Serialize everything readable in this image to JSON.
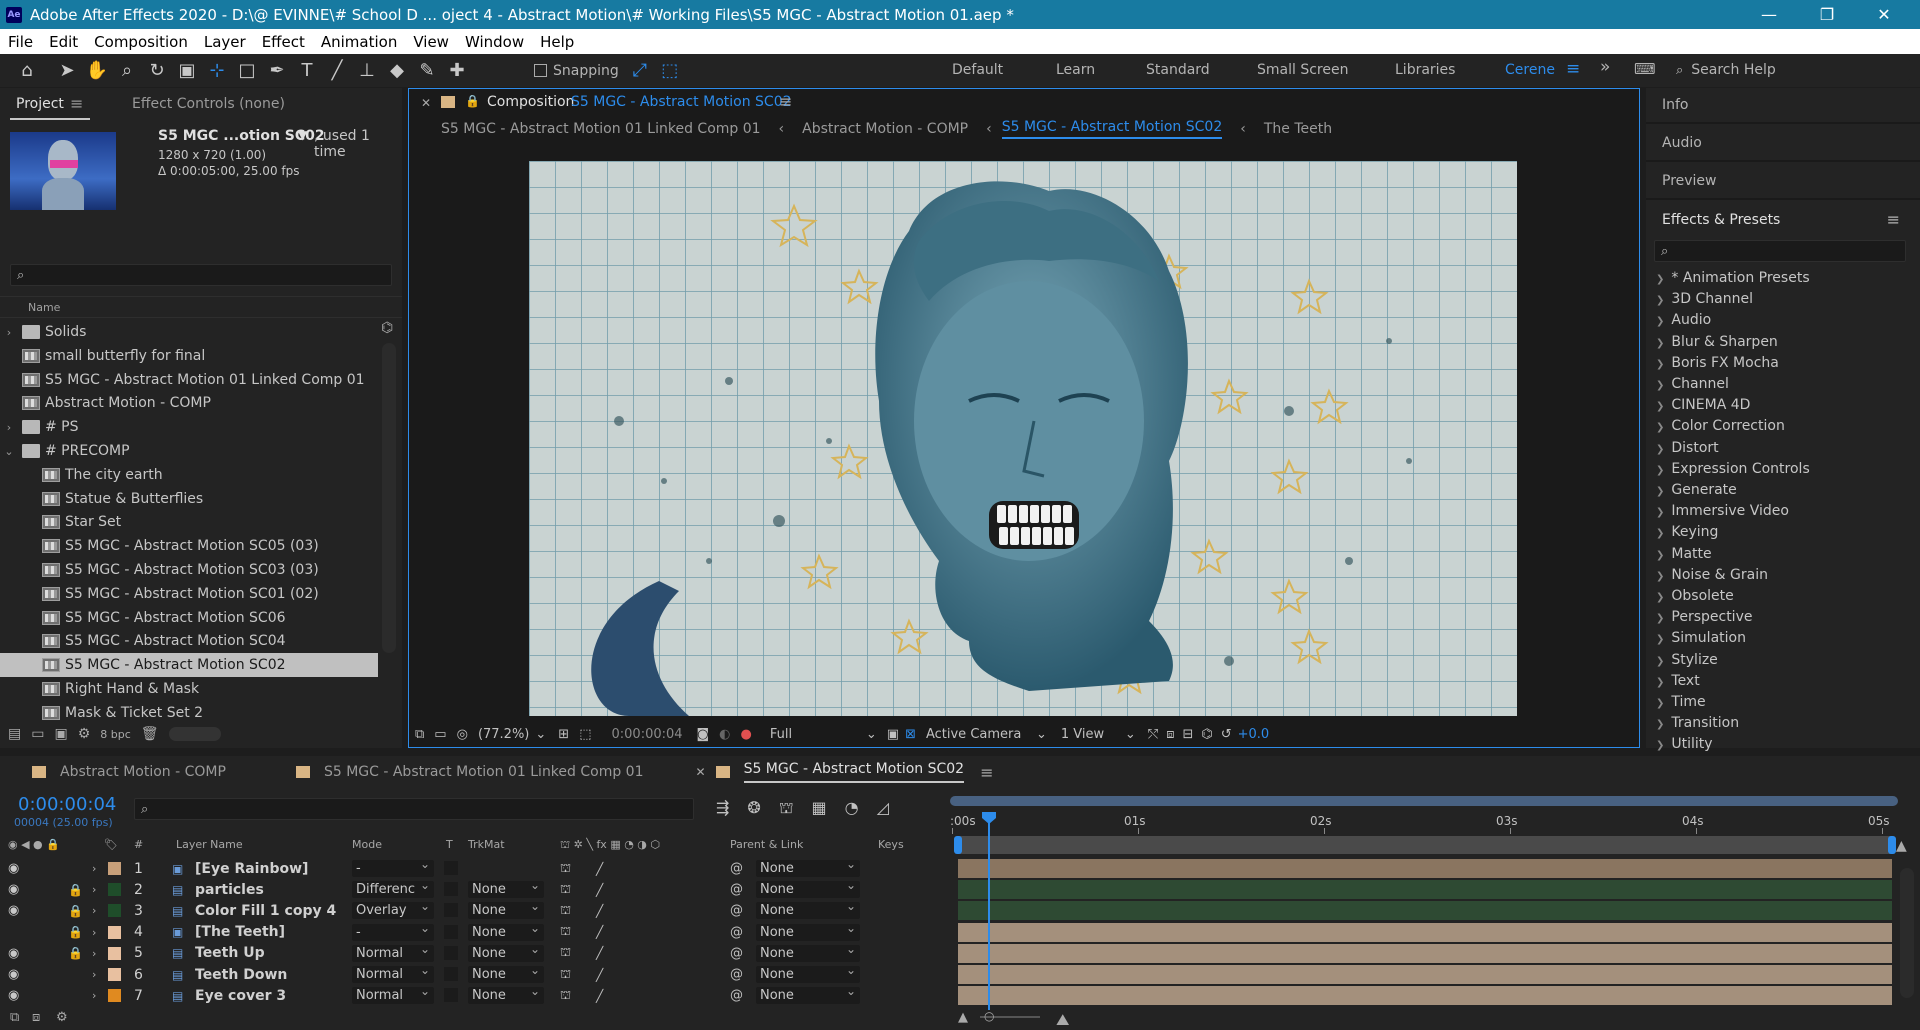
{
  "window": {
    "title": "Adobe After Effects 2020 - D:\\@ EVINNE\\# School D ... oject 4 - Abstract Motion\\# Working Files\\S5 MGC - Abstract Motion 01.aep *",
    "app_badge": "Ae",
    "controls": [
      "—",
      "❐",
      "✕"
    ]
  },
  "menu": [
    "File",
    "Edit",
    "Composition",
    "Layer",
    "Effect",
    "Animation",
    "View",
    "Window",
    "Help"
  ],
  "toolbar": {
    "snapping_label": "Snapping",
    "workspaces": [
      "Default",
      "Learn",
      "Standard",
      "Small Screen",
      "Libraries",
      "Cerene"
    ],
    "active_workspace": "Cerene",
    "search_help": "Search Help"
  },
  "project": {
    "tab_project": "Project",
    "tab_effect_controls": "Effect Controls (none)",
    "item_name": "S5 MGC ...otion SC02",
    "item_used": ", used 1 time",
    "item_dims": "1280 x 720 (1.00)",
    "item_duration": "Δ 0:00:05:00, 25.00 fps",
    "column_name": "Name",
    "bpc": "8 bpc",
    "items": [
      {
        "label": "Solids",
        "type": "folder",
        "indent": 0,
        "twisty": "›"
      },
      {
        "label": "small butterfly for final",
        "type": "comp",
        "indent": 0,
        "twisty": ""
      },
      {
        "label": "S5 MGC - Abstract Motion 01 Linked Comp 01",
        "type": "comp",
        "indent": 0,
        "twisty": ""
      },
      {
        "label": "Abstract Motion - COMP",
        "type": "comp",
        "indent": 0,
        "twisty": ""
      },
      {
        "label": "# PS",
        "type": "folder",
        "indent": 0,
        "twisty": "›"
      },
      {
        "label": "# PRECOMP",
        "type": "folder",
        "indent": 0,
        "twisty": "⌄"
      },
      {
        "label": "The city earth",
        "type": "comp",
        "indent": 1,
        "twisty": ""
      },
      {
        "label": "Statue & Butterflies",
        "type": "comp",
        "indent": 1,
        "twisty": ""
      },
      {
        "label": "Star Set",
        "type": "comp",
        "indent": 1,
        "twisty": ""
      },
      {
        "label": "S5 MGC - Abstract Motion SC05 (03)",
        "type": "comp",
        "indent": 1,
        "twisty": ""
      },
      {
        "label": "S5 MGC - Abstract Motion SC03 (03)",
        "type": "comp",
        "indent": 1,
        "twisty": ""
      },
      {
        "label": "S5 MGC - Abstract Motion SC01 (02)",
        "type": "comp",
        "indent": 1,
        "twisty": ""
      },
      {
        "label": "S5 MGC - Abstract Motion SC06",
        "type": "comp",
        "indent": 1,
        "twisty": ""
      },
      {
        "label": "S5 MGC - Abstract Motion SC04",
        "type": "comp",
        "indent": 1,
        "twisty": ""
      },
      {
        "label": "S5 MGC - Abstract Motion SC02",
        "type": "comp",
        "indent": 1,
        "twisty": "",
        "selected": true
      },
      {
        "label": "Right Hand & Mask",
        "type": "comp",
        "indent": 1,
        "twisty": ""
      },
      {
        "label": "Mask & Ticket Set 2",
        "type": "comp",
        "indent": 1,
        "twisty": ""
      }
    ]
  },
  "composition": {
    "prefix": "Composition",
    "name": "S5 MGC - Abstract Motion SC02",
    "breadcrumbs": [
      "S5 MGC - Abstract Motion 01 Linked Comp 01",
      "Abstract Motion - COMP",
      "S5 MGC - Abstract Motion SC02",
      "The Teeth"
    ],
    "active_breadcrumb": 2,
    "zoom": "(77.2%)",
    "timecode": "0:00:00:04",
    "resolution": "Full",
    "camera": "Active Camera",
    "views": "1 View",
    "exposure": "+0.0"
  },
  "right_panels": {
    "info": "Info",
    "audio": "Audio",
    "preview": "Preview",
    "effects_presets": "Effects & Presets",
    "effects": [
      "* Animation Presets",
      "3D Channel",
      "Audio",
      "Blur & Sharpen",
      "Boris FX Mocha",
      "Channel",
      "CINEMA 4D",
      "Color Correction",
      "Distort",
      "Expression Controls",
      "Generate",
      "Immersive Video",
      "Keying",
      "Matte",
      "Noise & Grain",
      "Obsolete",
      "Perspective",
      "Simulation",
      "Stylize",
      "Text",
      "Time",
      "Transition",
      "Utility"
    ]
  },
  "timeline": {
    "tabs": [
      "Abstract Motion - COMP",
      "S5 MGC - Abstract Motion 01 Linked Comp 01",
      "S5 MGC - Abstract Motion SC02"
    ],
    "active_tab": 2,
    "timecode": "0:00:00:04",
    "frame_info": "00004 (25.00 fps)",
    "columns": {
      "num": "#",
      "layer_name": "Layer Name",
      "mode": "Mode",
      "t": "T",
      "trkmat": "TrkMat",
      "parent": "Parent & Link",
      "keys": "Keys"
    },
    "ruler": [
      ":00s",
      "01s",
      "02s",
      "03s",
      "04s",
      "05s"
    ],
    "layers": [
      {
        "num": "1",
        "name": "[Eye Rainbow]",
        "mode": "-",
        "trkmat": "",
        "parent": "None",
        "color": "#c8a07a",
        "type": "comp",
        "eye": true,
        "lock": false,
        "bar": "#8a7560"
      },
      {
        "num": "2",
        "name": "particles",
        "mode": "Differenc",
        "trkmat": "None",
        "parent": "None",
        "color": "#1f4d2a",
        "type": "text",
        "eye": true,
        "lock": true,
        "bar": "#2e4a33"
      },
      {
        "num": "3",
        "name": "Color Fill 1 copy 4",
        "mode": "Overlay",
        "trkmat": "None",
        "parent": "None",
        "color": "#1f4d2a",
        "type": "text",
        "eye": true,
        "lock": true,
        "bar": "#2e4a33"
      },
      {
        "num": "4",
        "name": "[The Teeth]",
        "mode": "-",
        "trkmat": "None",
        "parent": "None",
        "color": "#e8c0a0",
        "type": "comp",
        "eye": false,
        "lock": true,
        "bar": "#a4907c"
      },
      {
        "num": "5",
        "name": "Teeth Up",
        "mode": "Normal",
        "trkmat": "None",
        "parent": "None",
        "color": "#e8c0a0",
        "type": "text",
        "eye": true,
        "lock": true,
        "bar": "#a4907c"
      },
      {
        "num": "6",
        "name": "Teeth Down",
        "mode": "Normal",
        "trkmat": "None",
        "parent": "None",
        "color": "#e8c0a0",
        "type": "text",
        "eye": true,
        "lock": false,
        "bar": "#a4907c"
      },
      {
        "num": "7",
        "name": "Eye cover 3",
        "mode": "Normal",
        "trkmat": "None",
        "parent": "None",
        "color": "#e08a20",
        "type": "text",
        "eye": true,
        "lock": false,
        "bar": "#a4907c"
      }
    ]
  }
}
